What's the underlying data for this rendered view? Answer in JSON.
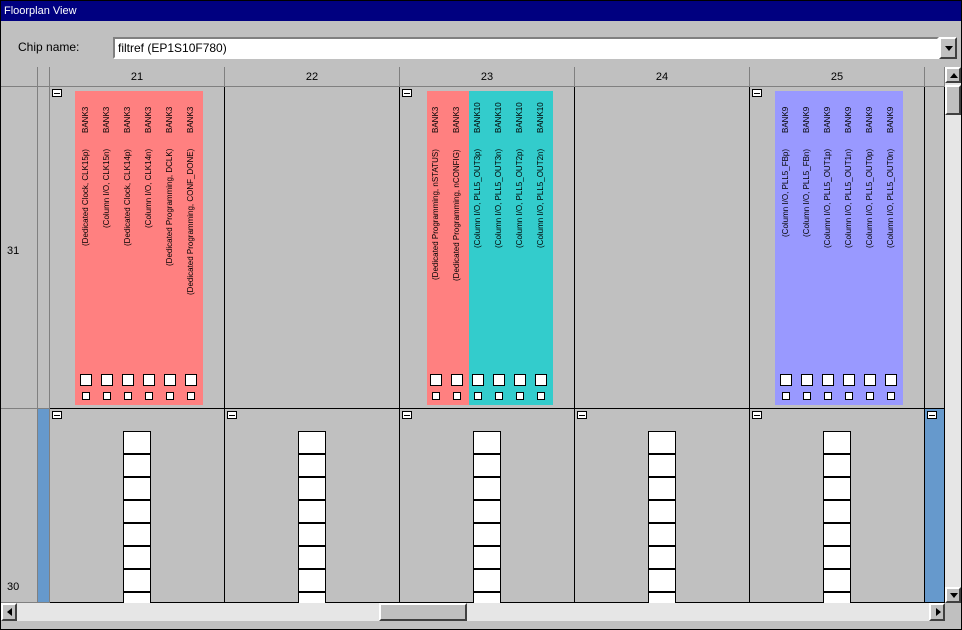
{
  "window": {
    "title": "Floorplan View"
  },
  "chip": {
    "label": "Chip name:",
    "value": "filtref (EP1S10F780)"
  },
  "columns": [
    "21",
    "22",
    "23",
    "24",
    "25"
  ],
  "rows": [
    "31",
    "30"
  ],
  "colors": {
    "bank3": "#ff8080",
    "bank10": "#33cccc",
    "bank9": "#9999ff",
    "edge": "#6699cc"
  },
  "row31": {
    "col21": {
      "pins": [
        {
          "bank": "BANK3",
          "func": "(Dedicated Clock, CLK15p)"
        },
        {
          "bank": "BANK3",
          "func": "(Column I/O, CLK15n)"
        },
        {
          "bank": "BANK3",
          "func": "(Dedicated Clock, CLK14p)"
        },
        {
          "bank": "BANK3",
          "func": "(Column I/O, CLK14n)"
        },
        {
          "bank": "BANK3",
          "func": "(Dedicated Programming, DCLK)"
        },
        {
          "bank": "BANK3",
          "func": "(Dedicated Programming, CONF_DONE)"
        }
      ]
    },
    "col23": {
      "pins": [
        {
          "bank": "BANK3",
          "func": "(Dedicated Programming, nSTATUS)"
        },
        {
          "bank": "BANK3",
          "func": "(Dedicated Programming, nCONFIG)"
        },
        {
          "bank": "BANK10",
          "func": "(Column I/O, PLL5_OUT3p)"
        },
        {
          "bank": "BANK10",
          "func": "(Column I/O, PLL5_OUT3n)"
        },
        {
          "bank": "BANK10",
          "func": "(Column I/O, PLL5_OUT2p)"
        },
        {
          "bank": "BANK10",
          "func": "(Column I/O, PLL5_OUT2n)"
        }
      ]
    },
    "col25": {
      "pins": [
        {
          "bank": "BANK9",
          "func": "(Column I/O, PLL5_FBp)"
        },
        {
          "bank": "BANK9",
          "func": "(Column I/O, PLL5_FBn)"
        },
        {
          "bank": "BANK9",
          "func": "(Column I/O, PLL5_OUT1p)"
        },
        {
          "bank": "BANK9",
          "func": "(Column I/O, PLL5_OUT1n)"
        },
        {
          "bank": "BANK9",
          "func": "(Column I/O, PLL5_OUT0p)"
        },
        {
          "bank": "BANK9",
          "func": "(Column I/O, PLL5_OUT0n)"
        }
      ]
    }
  }
}
